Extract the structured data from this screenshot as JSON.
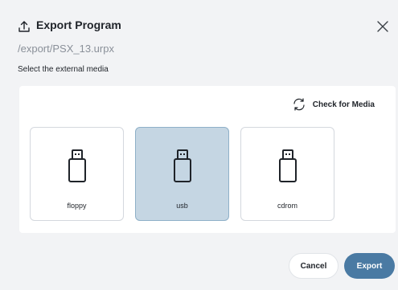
{
  "dialog": {
    "title": "Export Program",
    "path": "/export/PSX_13.urpx",
    "instruction": "Select the external media",
    "header_icon": "export-icon",
    "close_icon": "close-icon"
  },
  "media": {
    "check_label": "Check for Media",
    "check_icon": "refresh-icon",
    "items": [
      {
        "label": "floppy",
        "icon": "usb-drive-icon",
        "selected": false
      },
      {
        "label": "usb",
        "icon": "usb-drive-icon",
        "selected": true
      },
      {
        "label": "cdrom",
        "icon": "usb-drive-icon",
        "selected": false
      }
    ]
  },
  "footer": {
    "cancel_label": "Cancel",
    "export_label": "Export"
  },
  "colors": {
    "background": "#f2f3f5",
    "selected_tile": "#c5d6e3",
    "primary_button": "#4a7aa3"
  }
}
